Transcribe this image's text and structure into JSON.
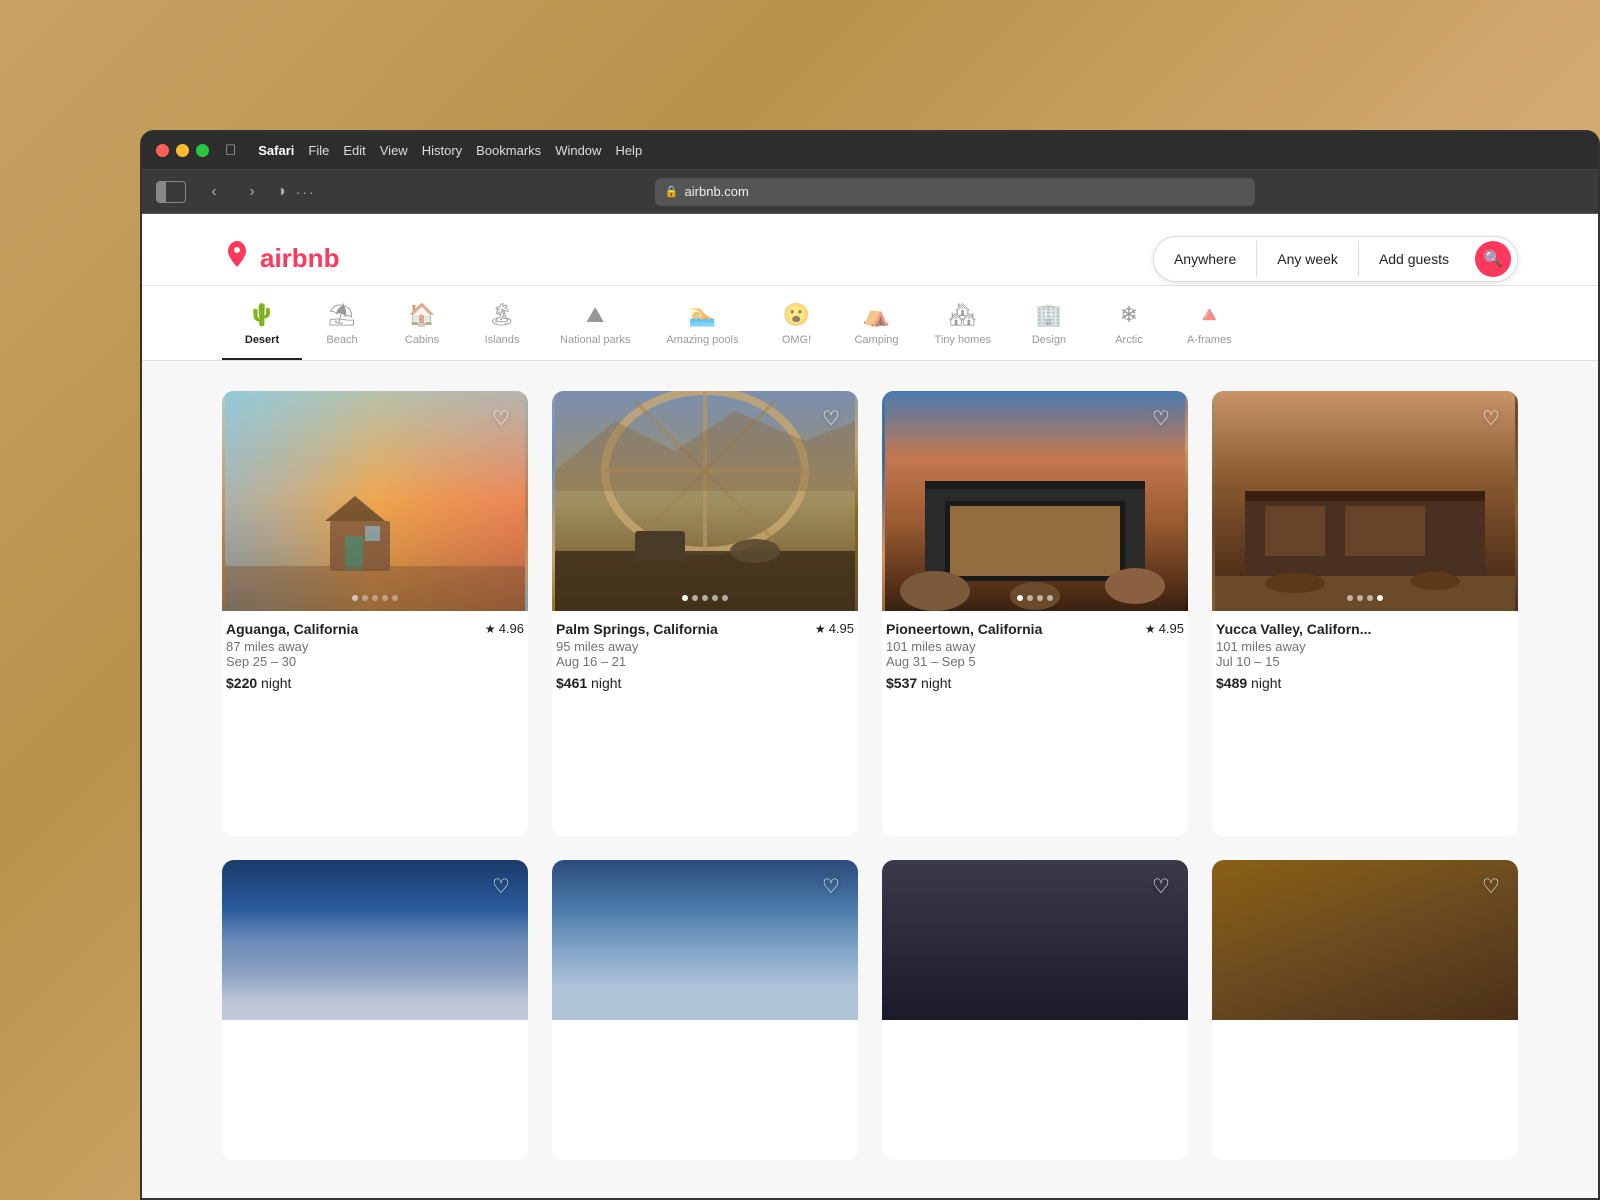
{
  "browser": {
    "os": "macOS",
    "app": "Safari",
    "menus": [
      "Safari",
      "File",
      "Edit",
      "View",
      "History",
      "Bookmarks",
      "Window",
      "Help"
    ],
    "url": "airbnb.com",
    "back_label": "‹",
    "forward_label": "›"
  },
  "header": {
    "logo_text": "airbnb",
    "search": {
      "anywhere": "Anywhere",
      "any_week": "Any week",
      "add_guests": "Add guests"
    }
  },
  "categories": [
    {
      "id": "desert",
      "label": "Desert",
      "icon": "🌵",
      "active": true
    },
    {
      "id": "beach",
      "label": "Beach",
      "icon": "⛱"
    },
    {
      "id": "cabins",
      "label": "Cabins",
      "icon": "🏠"
    },
    {
      "id": "islands",
      "label": "Islands",
      "icon": "🏝"
    },
    {
      "id": "national_parks",
      "label": "National parks",
      "icon": "⛰"
    },
    {
      "id": "amazing_pools",
      "label": "Amazing pools",
      "icon": "🏊"
    },
    {
      "id": "omg",
      "label": "OMG!",
      "icon": "😮"
    },
    {
      "id": "camping",
      "label": "Camping",
      "icon": "⛺"
    },
    {
      "id": "tiny_homes",
      "label": "Tiny homes",
      "icon": "🏘"
    },
    {
      "id": "design",
      "label": "Design",
      "icon": "🏢"
    },
    {
      "id": "arctic",
      "label": "Arctic",
      "icon": "❄"
    },
    {
      "id": "a_frames",
      "label": "A-frames",
      "icon": "🏔"
    }
  ],
  "listings": [
    {
      "id": 1,
      "location": "Aguanga, California",
      "rating": "4.96",
      "distance": "87 miles away",
      "dates": "Sep 25 – 30",
      "price": "$220",
      "price_label": "night",
      "img_class": "img-aguanga",
      "dots": 5,
      "active_dot": 0
    },
    {
      "id": 2,
      "location": "Palm Springs, California",
      "rating": "4.95",
      "distance": "95 miles away",
      "dates": "Aug 16 – 21",
      "price": "$461",
      "price_label": "night",
      "img_class": "img-palm",
      "dots": 5,
      "active_dot": 0
    },
    {
      "id": 3,
      "location": "Pioneertown, California",
      "rating": "4.95",
      "distance": "101 miles away",
      "dates": "Aug 31 – Sep 5",
      "price": "$537",
      "price_label": "night",
      "img_class": "img-pioneer",
      "dots": 4,
      "active_dot": 0
    },
    {
      "id": 4,
      "location": "Yucca Valley, Californ...",
      "rating": "—",
      "distance": "101 miles away",
      "dates": "Jul 10 – 15",
      "price": "$489",
      "price_label": "night",
      "img_class": "img-yucca",
      "dots": 4,
      "active_dot": 3
    }
  ],
  "listings_row2": [
    {
      "id": 5,
      "img_class": "img-bottom1"
    },
    {
      "id": 6,
      "img_class": "img-bottom2"
    },
    {
      "id": 7,
      "img_class": "img-bottom3"
    },
    {
      "id": 8,
      "img_class": "img-bottom4"
    }
  ]
}
